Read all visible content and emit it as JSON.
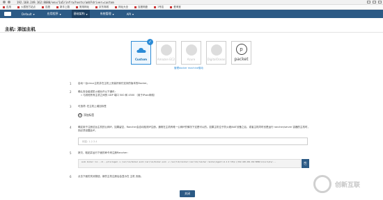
{
  "browser": {
    "url": "192.168.249.162:8080/env/1a5/infra/hosts/add?driver=custom"
  },
  "bookmarks": [
    "应用",
    "火狐官方站点",
    "百度",
    "新手上路",
    "常用网址",
    "京东商城",
    "网址大全",
    "百度网盘",
    "1号店",
    "爱淘宝"
  ],
  "nav": {
    "env": "Default",
    "items": [
      "应用程序",
      "基础架构",
      "系统管理",
      "API"
    ]
  },
  "page": {
    "title": "主机: 添加主机"
  },
  "drivers": [
    {
      "label": "Custom",
      "icon": "cloud-icon",
      "selected": true
    },
    {
      "label": "Amazon EC2",
      "icon": "aws-icon",
      "selected": false
    },
    {
      "label": "Azure",
      "icon": "azure-icon",
      "selected": false
    },
    {
      "label": "DigitalOcean",
      "icon": "digitalocean-icon",
      "selected": false
    },
    {
      "label": "packet",
      "icon": "packet-icon",
      "selected": false
    }
  ],
  "manage_link": "管理docker machine驱动",
  "steps": {
    "s1_num": "1",
    "s1_text": "启动一台Linux主机并在主机上安装好我们支持的版本的Docker。",
    "s2_num": "2",
    "s2_text": "确认安全组或防火墙允许以下通讯：",
    "s2_sub": "» 与其他所有主机之间的 UDP 端口 500 和 4500 （用于IPsec网络）",
    "s3_num": "3",
    "s3_text": "可选项: 在主机上增加标签",
    "s3_add": "添加标签",
    "s4_num": "4",
    "s4_text": "确定用于注册这台主机的公网IP。如果留空，Rancher会自动检测IP注册。通常在主机有唯一公网IP的情况下这是可以的。如果主机位于防火墙/NAT设备之后，或者主机同时也是运行 rancher/server 容器的主机时，则必须设置此IP。",
    "s4_placeholder": "例如: 1.2.3.4",
    "s5_num": "5",
    "s5_text": "拷贝，粘贴并运行下面的命令来注册Rancher：",
    "s5_cmd": "sudo docker run --rm --privileged -v /var/run/docker.sock:/var/run/docker.sock -v /var/lib/rancher:/var/lib/rancher rancher/agent:v1.2.9 http://192.168.249.162:8080/v1/scripts/...",
    "s6_num": "6",
    "s6_text": "点击下面的关闭按钮，新的主机注册后会显示在 主机 页面。"
  },
  "close_label": "关闭",
  "watermark": {
    "name": "创新互联"
  }
}
